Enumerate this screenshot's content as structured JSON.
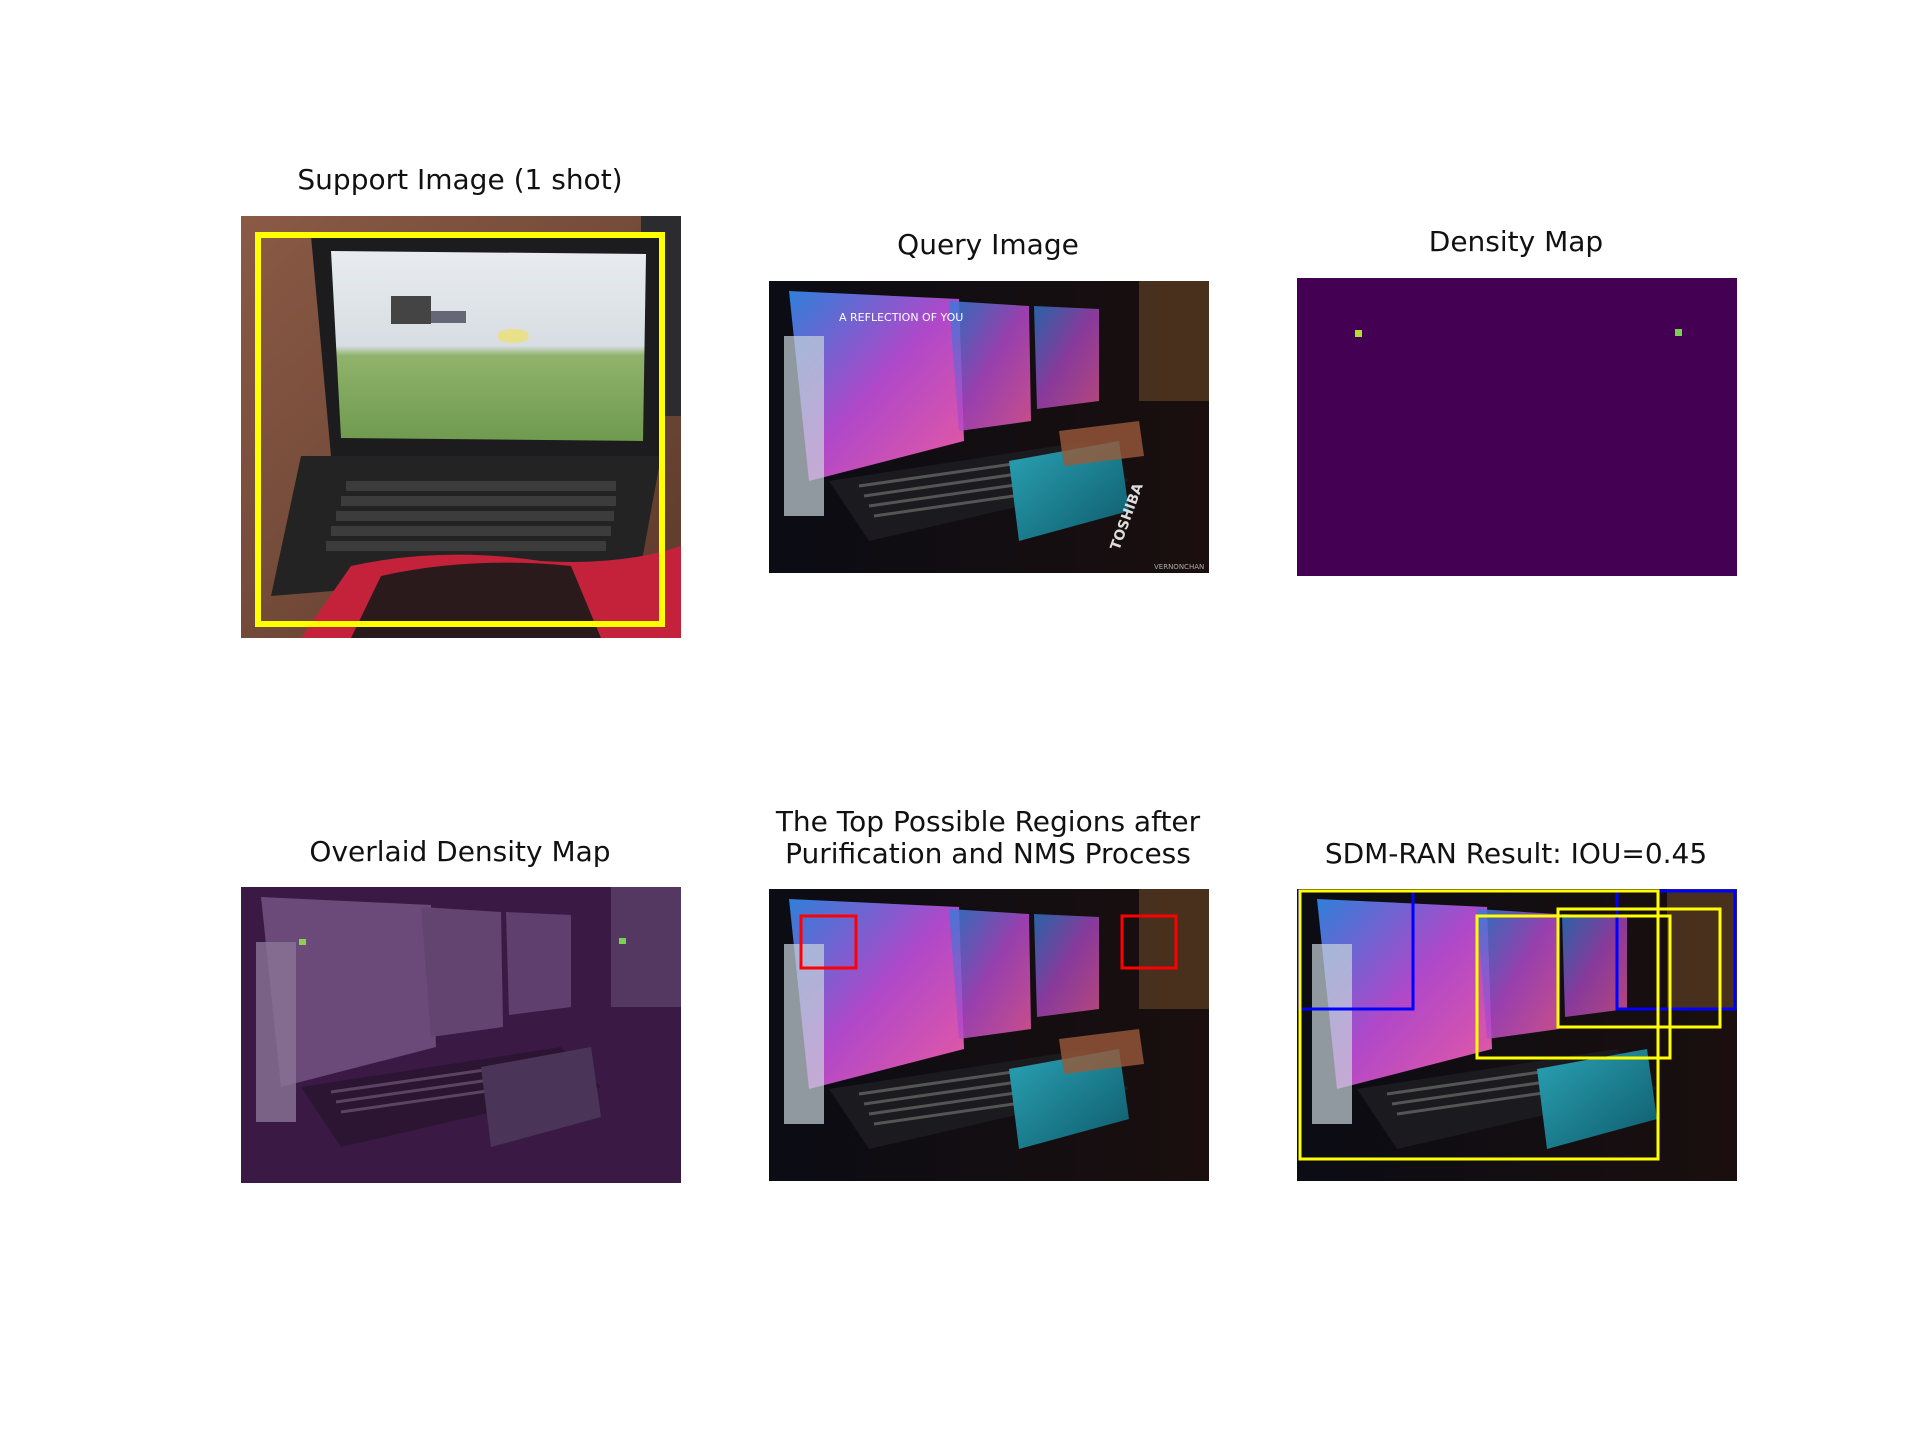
{
  "figure": {
    "panels": [
      {
        "title": "Support Image (1 shot)",
        "kind": "photo-support"
      },
      {
        "title": "Query Image",
        "kind": "photo-query"
      },
      {
        "title": "Density Map",
        "kind": "density-map"
      },
      {
        "title": "Overlaid Density Map",
        "kind": "photo-overlay"
      },
      {
        "title_line1": "The Top Possible Regions after",
        "title_line2": "Purification and NMS Process",
        "kind": "photo-regions"
      },
      {
        "title": "SDM-RAN Result: IOU=0.45",
        "kind": "photo-result"
      }
    ],
    "photo_text": {
      "screen_caption": "A REFLECTION OF YOU",
      "brand": "TOSHIBA",
      "watermark": "VERNONCHAN"
    },
    "colors": {
      "support_box": "#ffff00",
      "region_box": "#ff0000",
      "gt_box": "#0000ff",
      "pred_box": "#ffff00",
      "density_bg": "#440154",
      "density_peak": "#b5de2b"
    }
  }
}
